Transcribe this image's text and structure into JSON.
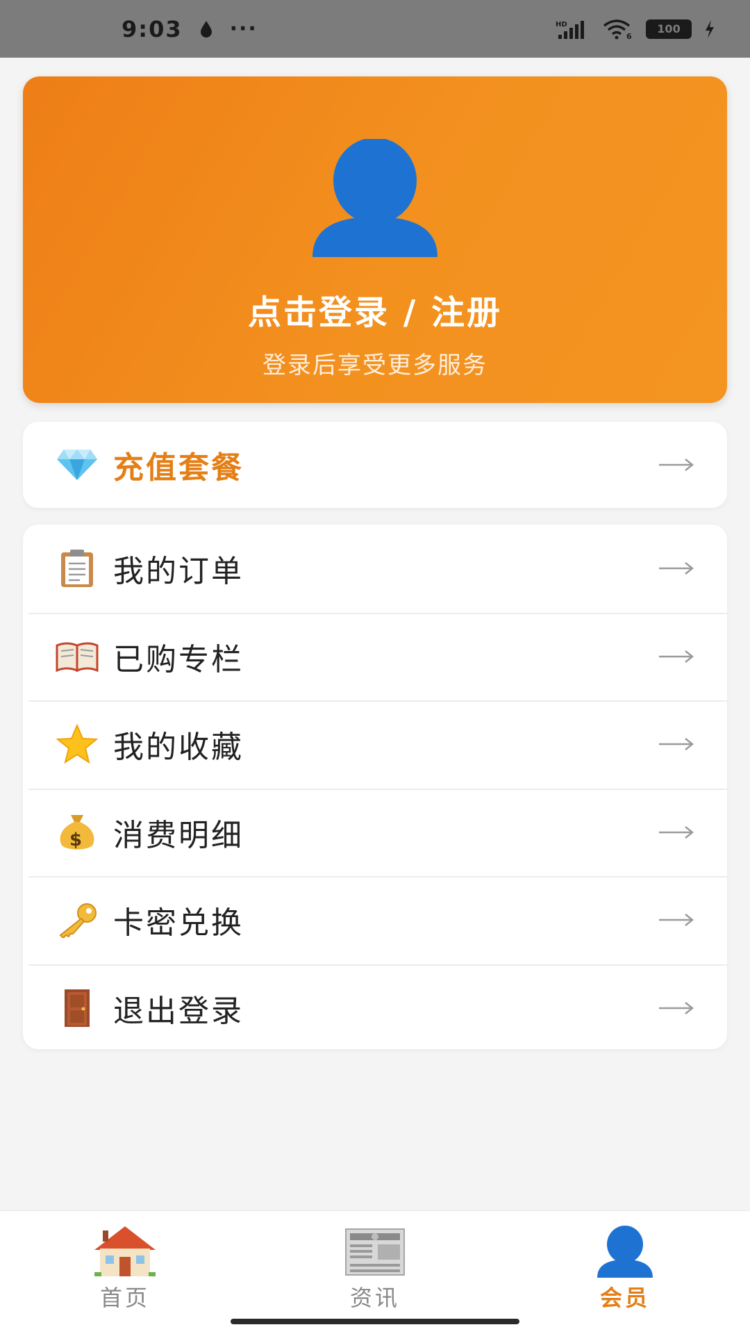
{
  "status_bar": {
    "time": "9:03",
    "dots": "···",
    "hd": "HD",
    "wifi_sub": "6",
    "battery": "100"
  },
  "profile": {
    "login_title": "点击登录 / 注册",
    "login_sub": "登录后享受更多服务",
    "avatar_color": "#1e73d2"
  },
  "recharge": {
    "label": "充值套餐",
    "icon": "diamond-icon"
  },
  "menu": {
    "items": [
      {
        "label": "我的订单",
        "icon": "clipboard-icon"
      },
      {
        "label": "已购专栏",
        "icon": "book-icon"
      },
      {
        "label": "我的收藏",
        "icon": "star-icon"
      },
      {
        "label": "消费明细",
        "icon": "money-bag-icon"
      },
      {
        "label": "卡密兑换",
        "icon": "key-icon"
      },
      {
        "label": "退出登录",
        "icon": "door-icon"
      }
    ]
  },
  "nav": {
    "items": [
      {
        "label": "首页",
        "icon": "house-icon"
      },
      {
        "label": "资讯",
        "icon": "newspaper-icon"
      },
      {
        "label": "会员",
        "icon": "member-icon"
      }
    ],
    "active_color": "#e47f16"
  }
}
